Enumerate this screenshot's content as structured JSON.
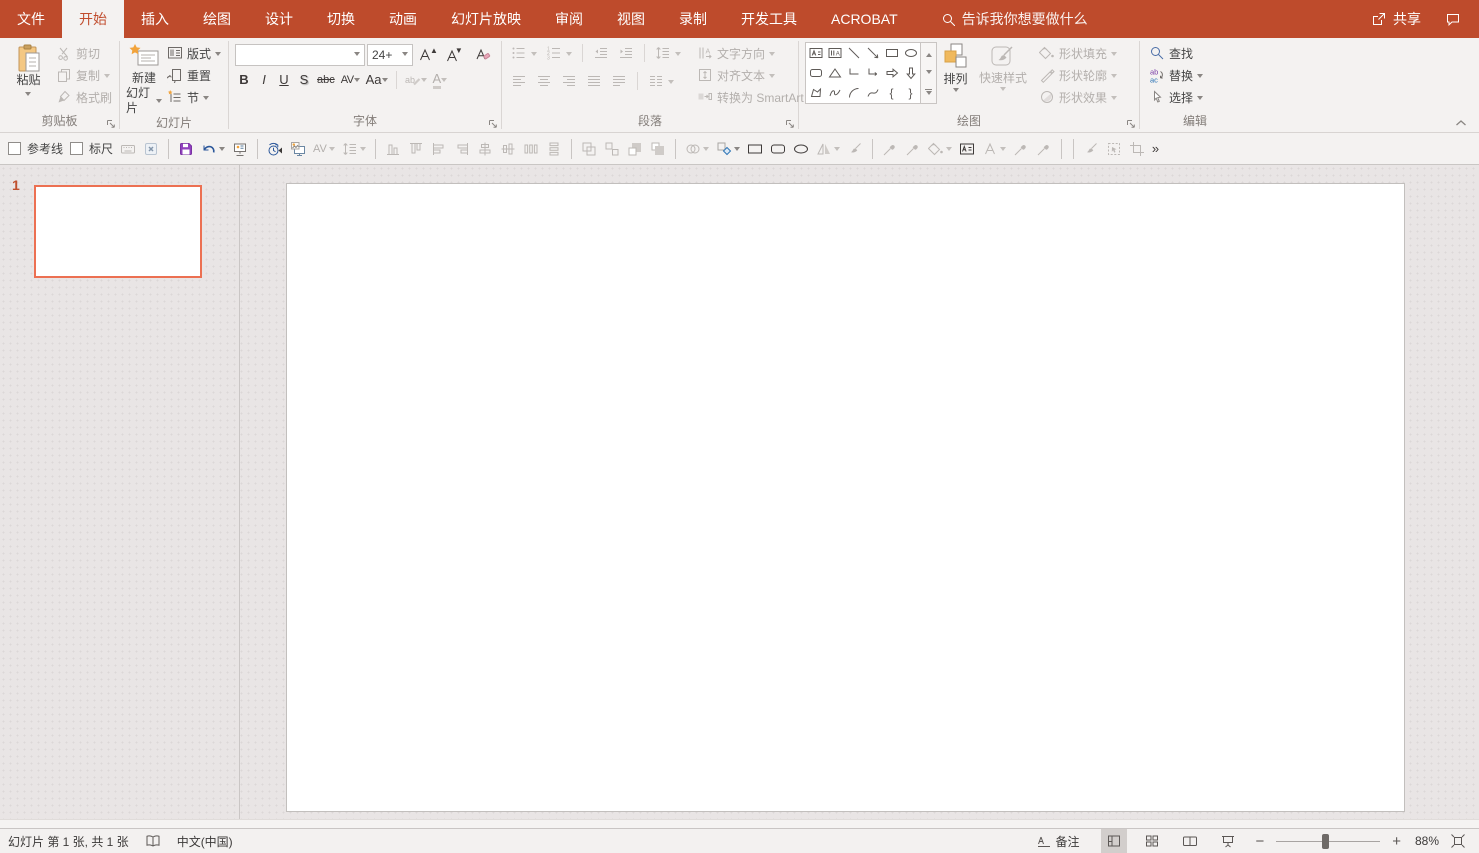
{
  "colors": {
    "accent": "#BE4B2C",
    "active_tab_text": "#C14D2E",
    "ribbon_bg": "#F4F2F1",
    "canvas_bg": "#E9E5E5",
    "thumbnail_border": "#EC7052",
    "save_icon": "#9141BE",
    "undo_icon": "#2B579A",
    "arrange_square": "#F0B95D",
    "status_active_bg": "#D2CECC"
  },
  "titlebar": {
    "tabs": [
      {
        "label": "文件"
      },
      {
        "label": "开始"
      },
      {
        "label": "插入"
      },
      {
        "label": "绘图"
      },
      {
        "label": "设计"
      },
      {
        "label": "切换"
      },
      {
        "label": "动画"
      },
      {
        "label": "幻灯片放映"
      },
      {
        "label": "审阅"
      },
      {
        "label": "视图"
      },
      {
        "label": "录制"
      },
      {
        "label": "开发工具"
      },
      {
        "label": "ACROBAT"
      }
    ],
    "search_placeholder": "告诉我你想要做什么",
    "share_label": "共享"
  },
  "ribbon": {
    "clipboard": {
      "paste": "粘贴",
      "cut": "剪切",
      "copy": "复制",
      "format_painter": "格式刷",
      "label": "剪贴板"
    },
    "slides": {
      "new_slide_1": "新建",
      "new_slide_2": "幻灯片",
      "layout": "版式",
      "reset": "重置",
      "section": "节",
      "label": "幻灯片"
    },
    "font": {
      "font_name": "",
      "font_size": "24+",
      "bold": "B",
      "italic": "I",
      "underline": "U",
      "shadow": "S",
      "strike": "abc",
      "char_spacing": "AV",
      "change_case": "Aa",
      "font_color": "A",
      "label": "字体"
    },
    "paragraph": {
      "text_direction": "文字方向",
      "align_text": "对齐文本",
      "smartart": "转换为 SmartArt",
      "label": "段落"
    },
    "drawing": {
      "arrange": "排列",
      "quick_styles": "快速样式",
      "shape_fill": "形状填充",
      "shape_outline": "形状轮廓",
      "shape_effects": "形状效果",
      "brace_left": "{",
      "brace_right": "}",
      "label": "绘图"
    },
    "editing": {
      "find": "查找",
      "replace": "替换",
      "select": "选择",
      "label": "编辑"
    }
  },
  "qat": {
    "guides_label": "参考线",
    "ruler_label": "标尺",
    "more_label": "»"
  },
  "slide_panel": {
    "slide_number": "1"
  },
  "statusbar": {
    "slide_info": "幻灯片 第 1 张, 共 1 张",
    "language": "中文(中国)",
    "notes_label": "备注",
    "zoom_level": "88%"
  }
}
